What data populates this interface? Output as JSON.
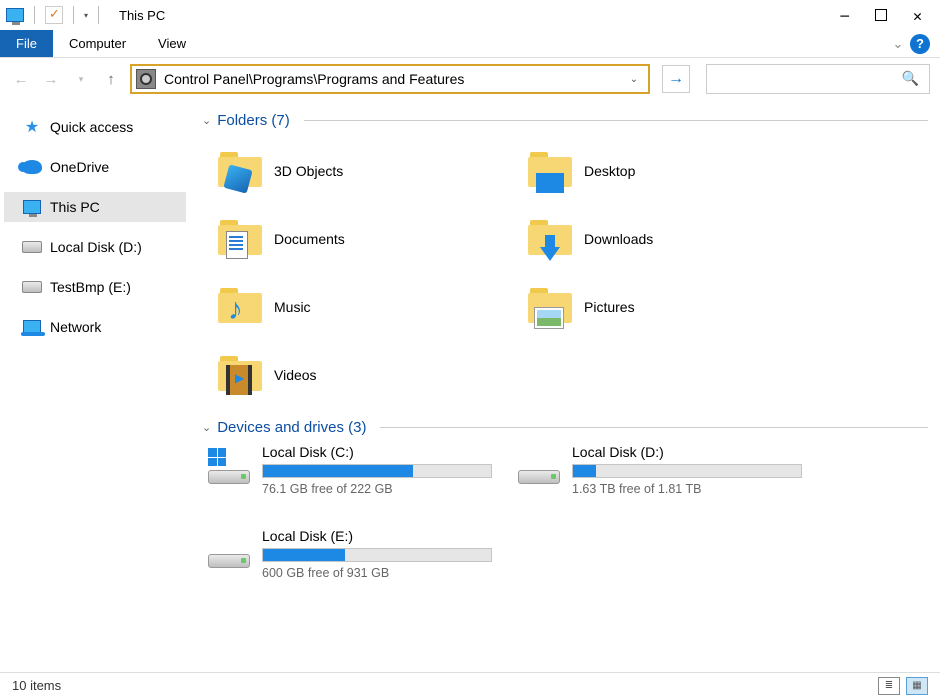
{
  "window": {
    "title": "This PC"
  },
  "ribbon": {
    "file": "File",
    "computer": "Computer",
    "view": "View"
  },
  "nav": {
    "address": "Control Panel\\Programs\\Programs and Features"
  },
  "sidebar": {
    "items": [
      {
        "label": "Quick access"
      },
      {
        "label": "OneDrive"
      },
      {
        "label": "This PC"
      },
      {
        "label": "Local Disk (D:)"
      },
      {
        "label": "TestBmp (E:)"
      },
      {
        "label": "Network"
      }
    ]
  },
  "groups": {
    "folders": {
      "title": "Folders (7)"
    },
    "drives": {
      "title": "Devices and drives (3)"
    }
  },
  "folders": [
    {
      "label": "3D Objects"
    },
    {
      "label": "Desktop"
    },
    {
      "label": "Documents"
    },
    {
      "label": "Downloads"
    },
    {
      "label": "Music"
    },
    {
      "label": "Pictures"
    },
    {
      "label": "Videos"
    }
  ],
  "drives": [
    {
      "name": "Local Disk (C:)",
      "free_text": "76.1 GB free of 222 GB",
      "fill_percent": 66,
      "system": true
    },
    {
      "name": "Local Disk (D:)",
      "free_text": "1.63 TB free of 1.81 TB",
      "fill_percent": 10,
      "system": false
    },
    {
      "name": "Local Disk (E:)",
      "free_text": "600 GB free of 931 GB",
      "fill_percent": 36,
      "system": false
    }
  ],
  "status": {
    "items": "10 items"
  }
}
